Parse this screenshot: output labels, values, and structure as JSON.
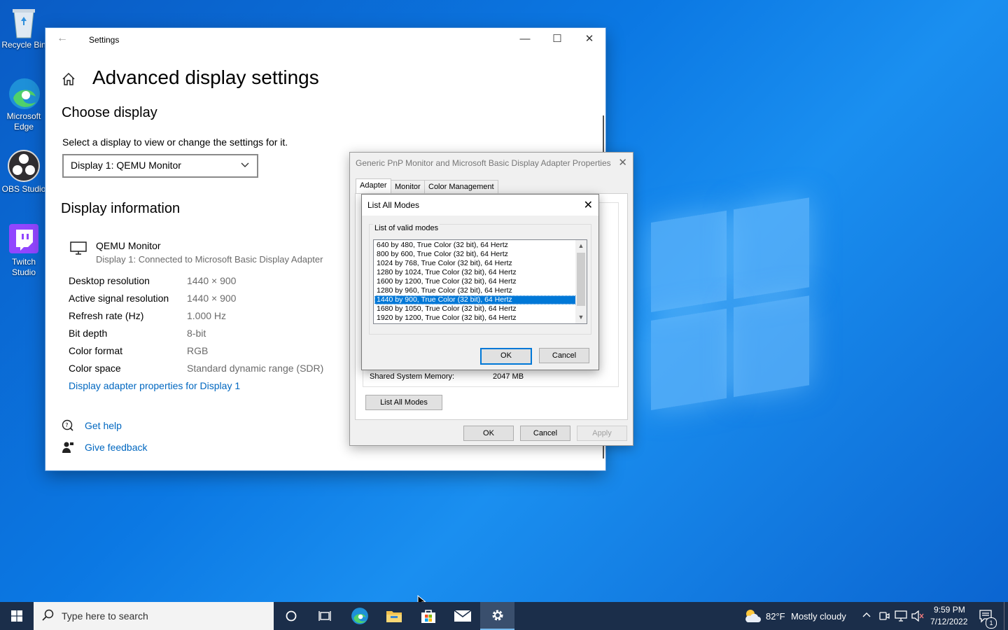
{
  "desktop": {
    "icons": [
      {
        "label": "Recycle Bin"
      },
      {
        "label": "Microsoft Edge"
      },
      {
        "label": "OBS Studio"
      },
      {
        "label": "Twitch Studio"
      }
    ]
  },
  "settings": {
    "window_title": "Settings",
    "page_title": "Advanced display settings",
    "choose_display_heading": "Choose display",
    "choose_display_desc": "Select a display to view or change the settings for it.",
    "display_select_value": "Display 1: QEMU Monitor",
    "display_info_heading": "Display information",
    "monitor_name": "QEMU Monitor",
    "monitor_desc": "Display 1: Connected to Microsoft Basic Display Adapter",
    "info_rows": [
      {
        "label": "Desktop resolution",
        "value": "1440 × 900"
      },
      {
        "label": "Active signal resolution",
        "value": "1440 × 900"
      },
      {
        "label": "Refresh rate (Hz)",
        "value": "1.000 Hz"
      },
      {
        "label": "Bit depth",
        "value": "8-bit"
      },
      {
        "label": "Color format",
        "value": "RGB"
      },
      {
        "label": "Color space",
        "value": "Standard dynamic range (SDR)"
      }
    ],
    "adapter_link": "Display adapter properties for Display 1",
    "get_help": "Get help",
    "give_feedback": "Give feedback"
  },
  "properties": {
    "title": "Generic PnP Monitor and Microsoft Basic Display Adapter Properties",
    "tabs": [
      "Adapter",
      "Monitor",
      "Color Management"
    ],
    "shared_memory_label": "Shared System Memory:",
    "shared_memory_value": "2047 MB",
    "list_all_modes_button": "List All Modes",
    "ok": "OK",
    "cancel": "Cancel",
    "apply": "Apply"
  },
  "modes_dialog": {
    "title": "List All Modes",
    "group_label": "List of valid modes",
    "modes": [
      "640 by 480, True Color (32 bit), 64 Hertz",
      "800 by 600, True Color (32 bit), 64 Hertz",
      "1024 by 768, True Color (32 bit), 64 Hertz",
      "1280 by 1024, True Color (32 bit), 64 Hertz",
      "1600 by 1200, True Color (32 bit), 64 Hertz",
      "1280 by 960, True Color (32 bit), 64 Hertz",
      "1440 by 900, True Color (32 bit), 64 Hertz",
      "1680 by 1050, True Color (32 bit), 64 Hertz",
      "1920 by 1200, True Color (32 bit), 64 Hertz"
    ],
    "selected_index": 6,
    "ok": "OK",
    "cancel": "Cancel"
  },
  "taskbar": {
    "search_placeholder": "Type here to search",
    "weather_temp": "82°F",
    "weather_desc": "Mostly cloudy",
    "time": "9:59 PM",
    "date": "7/12/2022",
    "notification_count": "1"
  },
  "colors": {
    "accent": "#0078d7",
    "link": "#0067c0",
    "taskbar": "#1b2e4a"
  }
}
